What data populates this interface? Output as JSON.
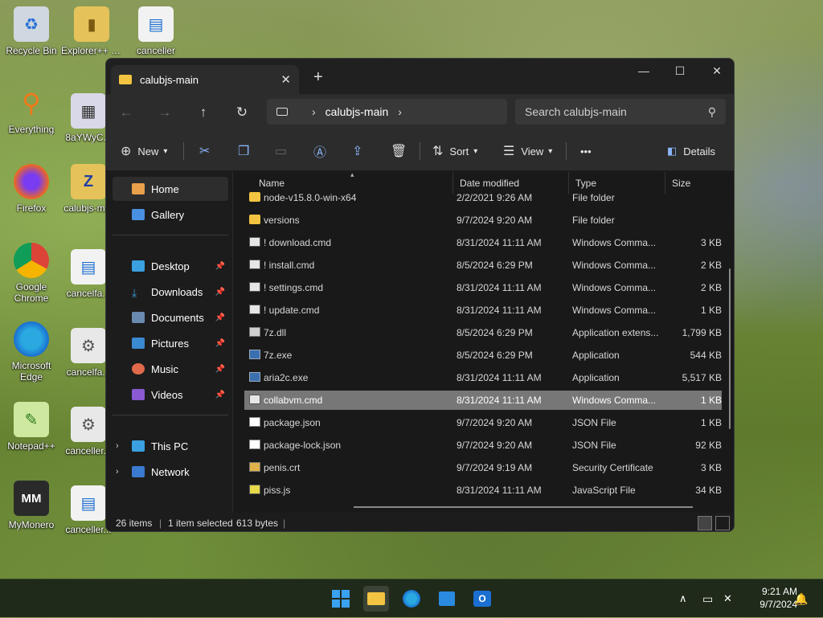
{
  "desktop": {
    "icons": [
      {
        "label": "Recycle Bin"
      },
      {
        "label": "Explorer++ Portable"
      },
      {
        "label": "canceller"
      },
      {
        "label": "Everything"
      },
      {
        "label": "8aYWyC..."
      },
      {
        "label": "Firefox"
      },
      {
        "label": "calubjs-m..."
      },
      {
        "label": "Google Chrome"
      },
      {
        "label": "cancelfa..."
      },
      {
        "label": "Microsoft Edge"
      },
      {
        "label": "cancelfa..."
      },
      {
        "label": "Notepad++"
      },
      {
        "label": "canceller..."
      },
      {
        "label": "MyMonero"
      },
      {
        "label": "canceller..."
      }
    ]
  },
  "window": {
    "tab_title": "calubjs-main",
    "close_tab": "✕",
    "new_tab": "+",
    "controls": {
      "minimize": "—",
      "maximize": "☐",
      "close": "✕"
    }
  },
  "nav": {
    "back": "←",
    "forward": "→",
    "up": "↑",
    "refresh": "↻",
    "address": {
      "segments": [
        "calubjs-main"
      ]
    },
    "search_placeholder": "Search calubjs-main"
  },
  "toolbar": {
    "new_label": "New",
    "sort_label": "Sort",
    "view_label": "View",
    "more_label": "•••",
    "details_label": "Details"
  },
  "sidebar": {
    "items": [
      {
        "label": "Home"
      },
      {
        "label": "Gallery"
      },
      {
        "label": "Desktop"
      },
      {
        "label": "Downloads"
      },
      {
        "label": "Documents"
      },
      {
        "label": "Pictures"
      },
      {
        "label": "Music"
      },
      {
        "label": "Videos"
      },
      {
        "label": "This PC"
      },
      {
        "label": "Network"
      }
    ]
  },
  "columns": {
    "name": "Name",
    "date": "Date modified",
    "type": "Type",
    "size": "Size"
  },
  "files": [
    {
      "name": "node-v15.8.0-win-x64",
      "date": "2/2/2021 9:26 AM",
      "type": "File folder",
      "size": "",
      "kind": "folder"
    },
    {
      "name": "versions",
      "date": "9/7/2024 9:20 AM",
      "type": "File folder",
      "size": "",
      "kind": "folder"
    },
    {
      "name": "! download.cmd",
      "date": "8/31/2024 11:11 AM",
      "type": "Windows Comma...",
      "size": "3 KB",
      "kind": "cmdf"
    },
    {
      "name": "! install.cmd",
      "date": "8/5/2024 6:29 PM",
      "type": "Windows Comma...",
      "size": "2 KB",
      "kind": "cmdf"
    },
    {
      "name": "! settings.cmd",
      "date": "8/31/2024 11:11 AM",
      "type": "Windows Comma...",
      "size": "2 KB",
      "kind": "cmdf"
    },
    {
      "name": "! update.cmd",
      "date": "8/31/2024 11:11 AM",
      "type": "Windows Comma...",
      "size": "1 KB",
      "kind": "cmdf"
    },
    {
      "name": "7z.dll",
      "date": "8/5/2024 6:29 PM",
      "type": "Application extens...",
      "size": "1,799 KB",
      "kind": "dll"
    },
    {
      "name": "7z.exe",
      "date": "8/5/2024 6:29 PM",
      "type": "Application",
      "size": "544 KB",
      "kind": "app"
    },
    {
      "name": "aria2c.exe",
      "date": "8/31/2024 11:11 AM",
      "type": "Application",
      "size": "5,517 KB",
      "kind": "app"
    },
    {
      "name": "collabvm.cmd",
      "date": "8/31/2024 11:11 AM",
      "type": "Windows Comma...",
      "size": "1 KB",
      "kind": "cmdf",
      "selected": true
    },
    {
      "name": "package.json",
      "date": "9/7/2024 9:20 AM",
      "type": "JSON File",
      "size": "1 KB",
      "kind": "json"
    },
    {
      "name": "package-lock.json",
      "date": "9/7/2024 9:20 AM",
      "type": "JSON File",
      "size": "92 KB",
      "kind": "json"
    },
    {
      "name": "penis.crt",
      "date": "9/7/2024 9:19 AM",
      "type": "Security Certificate",
      "size": "3 KB",
      "kind": "cert"
    },
    {
      "name": "piss.js",
      "date": "8/31/2024 11:11 AM",
      "type": "JavaScript File",
      "size": "34 KB",
      "kind": "js"
    }
  ],
  "status": {
    "items": "26 items",
    "selected": "1 item selected",
    "bytes": "613 bytes"
  },
  "taskbar": {
    "time": "9:21 AM",
    "date": "9/7/2024"
  },
  "colors": {
    "accent": "#8ab4f8",
    "folder": "#f3c441",
    "selection": "#777777"
  }
}
